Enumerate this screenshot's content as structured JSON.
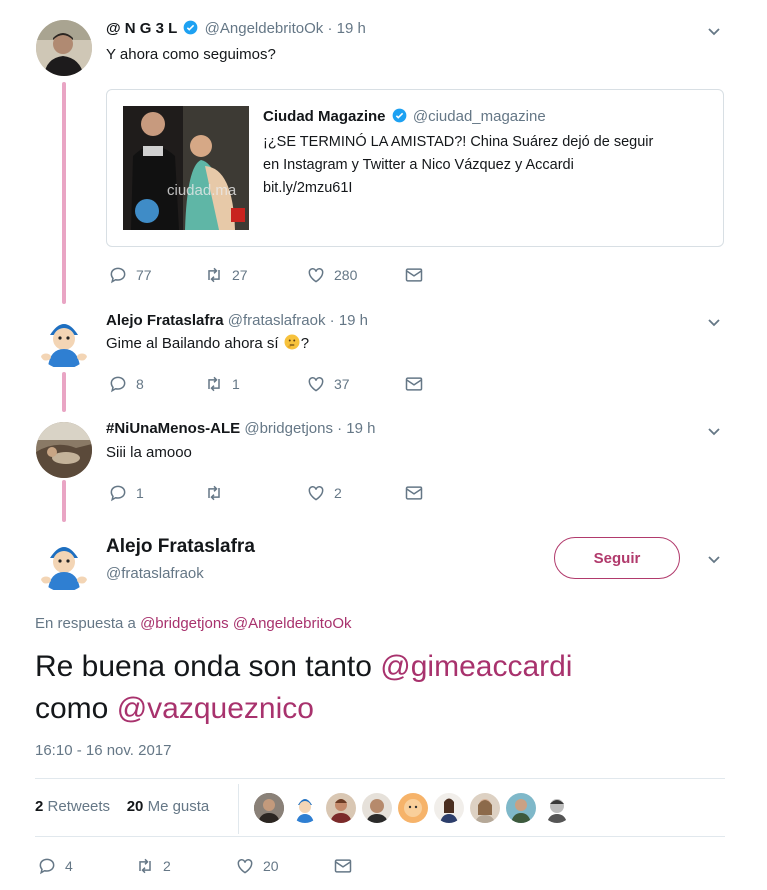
{
  "colors": {
    "accent": "#a8326d",
    "thread": "#e9a5c4",
    "muted": "#657786",
    "verified": "#1da1f2"
  },
  "tweets": [
    {
      "name": "@ N G 3 L",
      "verified": true,
      "handle": "@AngeldebritoOk",
      "time": "· 19 h",
      "text": "Y ahora como seguimos?",
      "card": {
        "name": "Ciudad Magazine",
        "verified": true,
        "handle": "@ciudad_magazine",
        "line1": "¡¿SE TERMINÓ LA AMISTAD?! China Suárez dejó de seguir",
        "line2": "en Instagram y Twitter a Nico Vázquez y Accardi",
        "line3": "bit.ly/2mzu61I",
        "image_caption": "ciudad.ma"
      },
      "replies": "77",
      "retweets": "27",
      "likes": "280"
    },
    {
      "name": "Alejo Frataslafra",
      "handle": "@frataslafraok",
      "time": "· 19 h",
      "text": "Gime al Bailando ahora sí",
      "text_suffix": "?",
      "emoji": "thinking-face-emoji",
      "replies": "8",
      "retweets": "1",
      "likes": "37"
    },
    {
      "name": "#NiUnaMenos-ALE",
      "handle": "@bridgetjons",
      "time": "· 19 h",
      "text": "Siii la amooo",
      "replies": "1",
      "retweets": "",
      "likes": "2"
    }
  ],
  "main": {
    "name": "Alejo Frataslafra",
    "handle": "@frataslafraok",
    "follow_label": "Seguir",
    "reply_prefix": "En respuesta a",
    "reply_to_1": "@bridgetjons",
    "reply_to_2": "@AngeldebritoOk",
    "text_part1": "Re buena onda son tanto ",
    "mention_1": "@gimeaccardi",
    "text_part2": "como ",
    "mention_2": "@vazqueznico",
    "timestamp": "16:10 - 16 nov. 2017",
    "retweets_count": "2",
    "retweets_label": "Retweets",
    "likes_count": "20",
    "likes_label": "Me gusta",
    "replies": "4",
    "retweets": "2",
    "likes": "20"
  }
}
